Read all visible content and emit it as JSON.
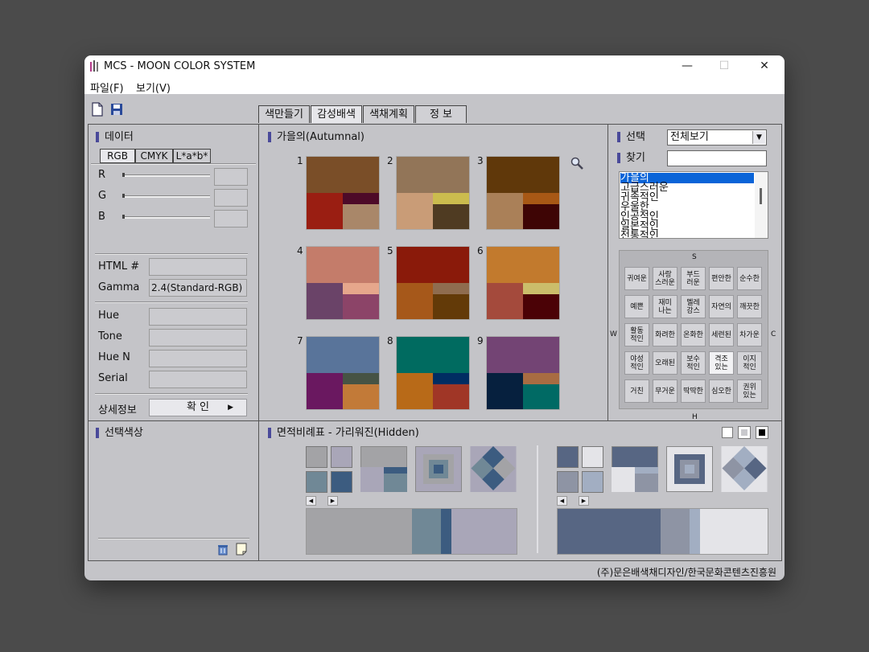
{
  "window": {
    "title": "MCS - MOON COLOR SYSTEM",
    "min": "—",
    "max": "☐",
    "close": "✕"
  },
  "menu": [
    {
      "label": "파일(F)"
    },
    {
      "label": "보기(V)"
    }
  ],
  "tabs": [
    {
      "label": "색만들기"
    },
    {
      "label": "감성배색"
    },
    {
      "label": "색채계획"
    },
    {
      "label": "정 보"
    }
  ],
  "data_panel": {
    "title": "데이터",
    "subtabs": [
      "RGB",
      "CMYK",
      "L*a*b*"
    ],
    "rgb_labels": [
      "R",
      "G",
      "B"
    ],
    "html_label": "HTML #",
    "gamma_label": "Gamma",
    "gamma_value": "2.4(Standard-RGB)",
    "hue_label": "Hue",
    "tone_label": "Tone",
    "huen_label": "Hue N",
    "serial_label": "Serial",
    "detail_label": "상세정보",
    "confirm_label": "확 인",
    "confirm_arrow": "▶"
  },
  "palette_panel": {
    "title": "가을의(Autumnal)",
    "zoom_icon": "magnifier-icon",
    "swatches": [
      {
        "num": "1",
        "top": "#7a4e28",
        "bl": "#9a1e12",
        "tr": "#4d0a28",
        "br": "#a98769"
      },
      {
        "num": "2",
        "top": "#927558",
        "bl": "#c99c77",
        "tr": "#cbbc4e",
        "br": "#4f3b22"
      },
      {
        "num": "3",
        "top": "#60380a",
        "bl": "#aa8058",
        "tr": "#a85815",
        "br": "#3e0505"
      },
      {
        "num": "4",
        "top": "#c47c6a",
        "bl": "#6a4368",
        "tr": "#e6a78c",
        "br": "#8c4468"
      },
      {
        "num": "5",
        "top": "#8a1a0a",
        "bl": "#a6581a",
        "tr": "#8f6c4f",
        "br": "#633a08"
      },
      {
        "num": "6",
        "top": "#c27a2d",
        "bl": "#a44a3c",
        "tr": "#cbbd6a",
        "br": "#4b0206"
      },
      {
        "num": "7",
        "top": "#59749a",
        "bl": "#6a1860",
        "tr": "#465344",
        "br": "#c27a38"
      },
      {
        "num": "8",
        "top": "#006b60",
        "bl": "#b86a18",
        "tr": "#002d62",
        "br": "#a03626"
      },
      {
        "num": "9",
        "top": "#734474",
        "bl": "#06203e",
        "tr": "#a86c42",
        "br": "#006a64"
      }
    ]
  },
  "select_panel": {
    "select_label": "선택",
    "select_value": "전체보기",
    "find_label": "찾기",
    "list": [
      "가을의",
      "고급스러운",
      "귀족적인",
      "우울한",
      "인공적인",
      "일본적인",
      "전통적인"
    ],
    "axis": {
      "top": "S",
      "bottom": "H",
      "left": "W",
      "right": "C"
    },
    "keywords": [
      [
        "귀여운",
        "사랑 스러운",
        "부드 러운",
        "편안한",
        "순수한"
      ],
      [
        "예쁜",
        "재미 나는",
        "멜레 강스",
        "자연의",
        "깨끗한"
      ],
      [
        "활동 적인",
        "화려한",
        "온화한",
        "세련된",
        "차가운"
      ],
      [
        "야성 적인",
        "오래된",
        "보수 적인",
        "격조 있는",
        "이지 적인"
      ],
      [
        "거친",
        "무거운",
        "딱딱한",
        "심오한",
        "권위 있는"
      ]
    ]
  },
  "selected_panel": {
    "title": "선택색상",
    "trash_icon": "trash-icon",
    "note_icon": "note-icon"
  },
  "area_panel": {
    "title": "면적비례표 - 가리워진(Hidden)",
    "left_colors": [
      "#a3a3a6",
      "#a9a6b8",
      "#708896",
      "#3c5c80"
    ],
    "right_colors": [
      "#576683",
      "#e4e4e8",
      "#8e94a4",
      "#a2aec2"
    ],
    "left_bar": [
      {
        "color": "#a3a3a6",
        "pct": 50
      },
      {
        "color": "#708896",
        "pct": 14
      },
      {
        "color": "#3c5c80",
        "pct": 5
      },
      {
        "color": "#a9a6b8",
        "pct": 31
      }
    ],
    "right_bar": [
      {
        "color": "#576683",
        "pct": 49
      },
      {
        "color": "#8e94a4",
        "pct": 14
      },
      {
        "color": "#a2aec2",
        "pct": 5
      },
      {
        "color": "#e4e4e8",
        "pct": 32
      }
    ],
    "arrow_left": "◀",
    "arrow_right": "▶"
  },
  "footer": {
    "text": "(주)문은배색채디자인/한국문화콘텐츠진흥원"
  }
}
